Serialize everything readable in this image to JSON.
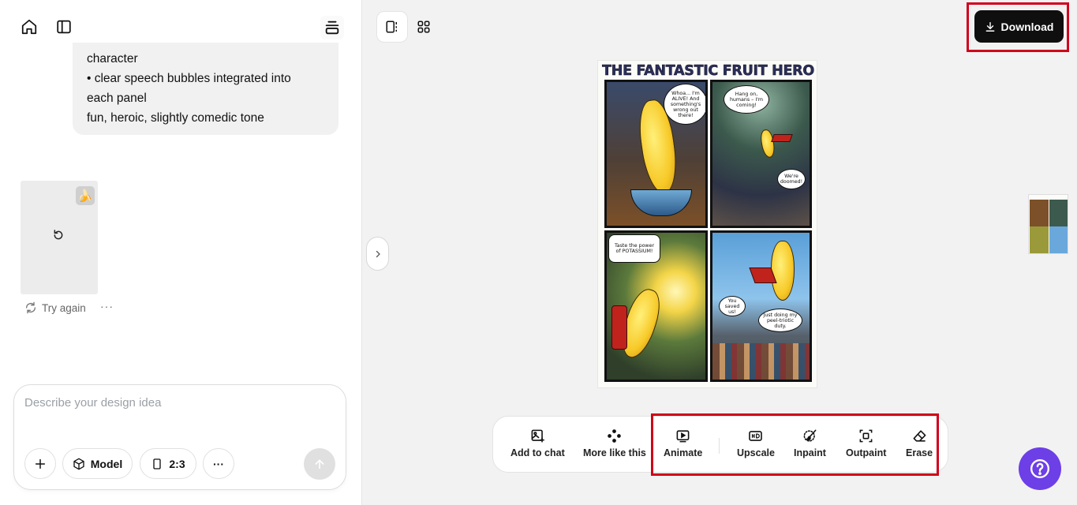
{
  "left_panel": {
    "message_lines": [
      "character",
      "• clear speech bubbles integrated into",
      "each panel",
      "fun, heroic, slightly comedic tone"
    ],
    "generation": {
      "badge_emoji": "🍌",
      "retry_label": "Try again",
      "more_label": "···"
    },
    "composer": {
      "placeholder": "Describe your design idea",
      "plus_label": "+",
      "model_label": "Model",
      "ratio_label": "2:3",
      "more_label": "···"
    }
  },
  "header": {
    "download_label": "Download"
  },
  "comic": {
    "title": "THE FANTASTIC FRUIT HERO",
    "bubbles": [
      "Whoa... I'm ALIVE! And something's wrong out there!",
      "Hang on, humans – I'm coming!",
      "We're doomed!",
      "Taste the power of POTASSIUM!",
      "You saved us!",
      "Just doing my peel-triotic duty."
    ]
  },
  "toolbar": {
    "items": [
      {
        "label": "Add to chat",
        "icon": "image-plus-icon"
      },
      {
        "label": "More like this",
        "icon": "nodes-icon"
      },
      {
        "label": "Animate",
        "icon": "play-frame-icon"
      },
      {
        "label": "Upscale",
        "icon": "hd-icon"
      },
      {
        "label": "Inpaint",
        "icon": "brush-icon"
      },
      {
        "label": "Outpaint",
        "icon": "expand-icon"
      },
      {
        "label": "Erase",
        "icon": "eraser-icon"
      }
    ]
  },
  "colors": {
    "highlight": "#d0021b",
    "download_bg": "#0f0f0f",
    "help_bg": "#6d3fe6"
  }
}
